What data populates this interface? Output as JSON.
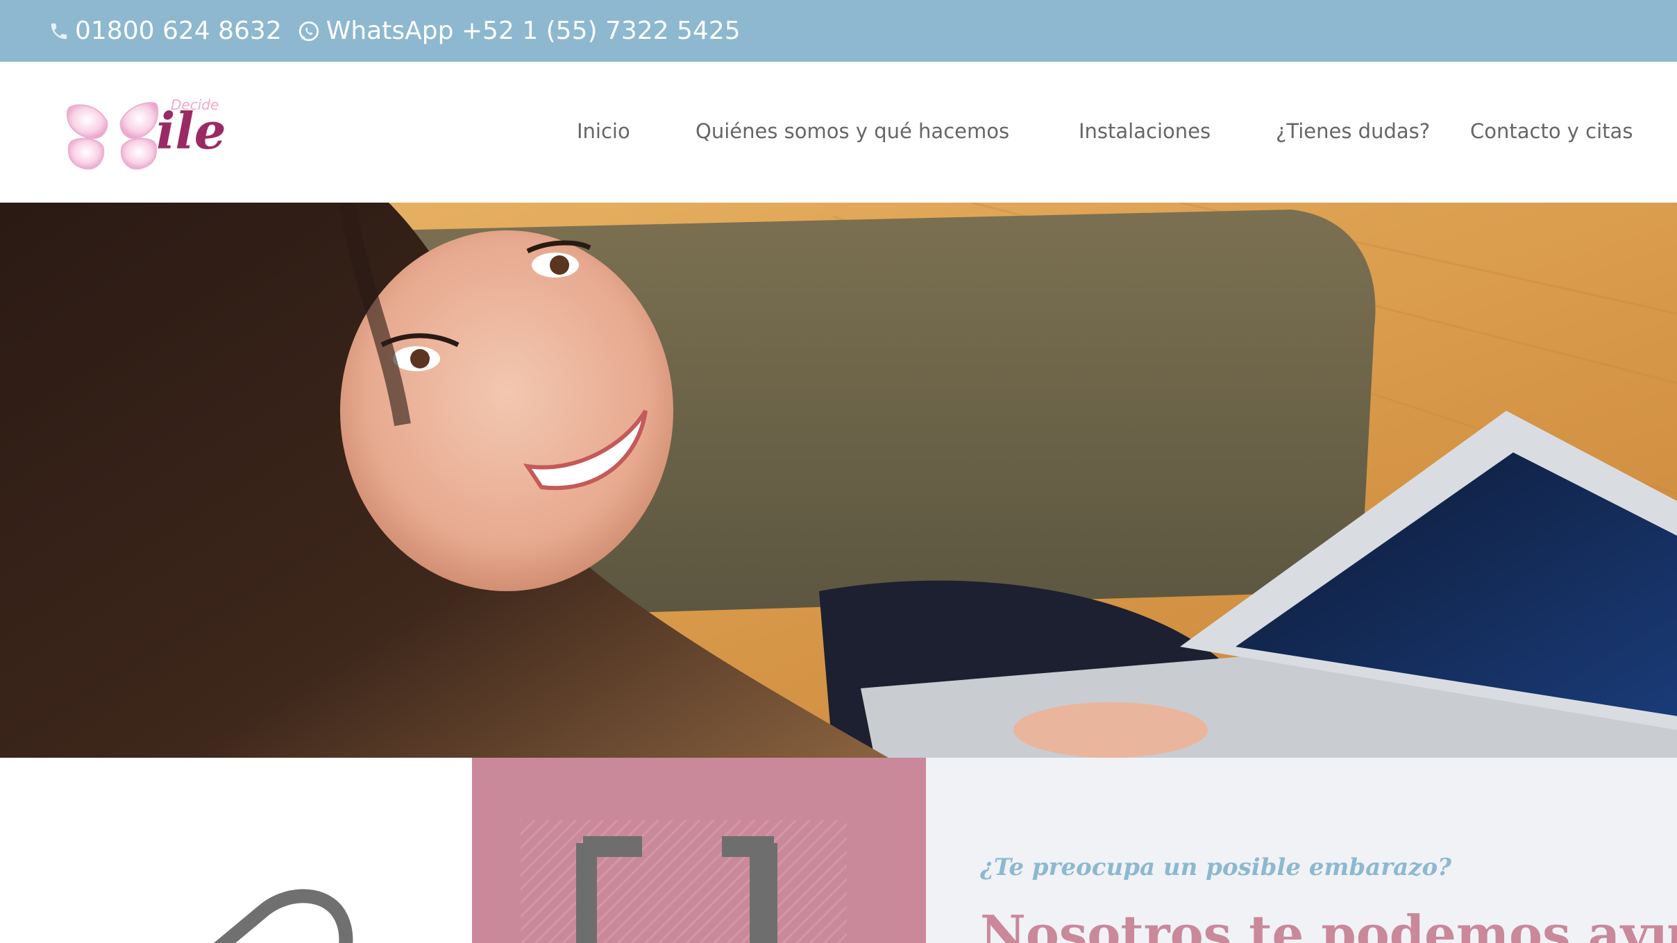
{
  "topbar": {
    "phone_icon": "phone-icon",
    "phone": "01800 624 8632",
    "whatsapp_icon": "whatsapp-icon",
    "whatsapp": "WhatsApp +52 1 (55) 7322 5425"
  },
  "logo": {
    "icon": "butterfly-icon",
    "decide": "Decide",
    "ile": "ile"
  },
  "nav": {
    "items": [
      {
        "label": "Inicio"
      },
      {
        "label": "Quiénes somos y qué hacemos"
      },
      {
        "label": "Instalaciones"
      },
      {
        "label": "¿Tienes dudas?"
      },
      {
        "label": "Contacto y citas"
      }
    ]
  },
  "features": {
    "icon_1": "tag-icon",
    "icon_2": "magnet-icon"
  },
  "intro": {
    "question": "¿Te preocupa un posible embarazo?",
    "heading": "Nosotros te podemos ayudar"
  },
  "colors": {
    "topbar": "#8db8cf",
    "accent_pink": "#c9899a",
    "logo_magenta": "#9a2a63",
    "nav_text": "#666666",
    "light_panel": "#f0f2f6"
  }
}
